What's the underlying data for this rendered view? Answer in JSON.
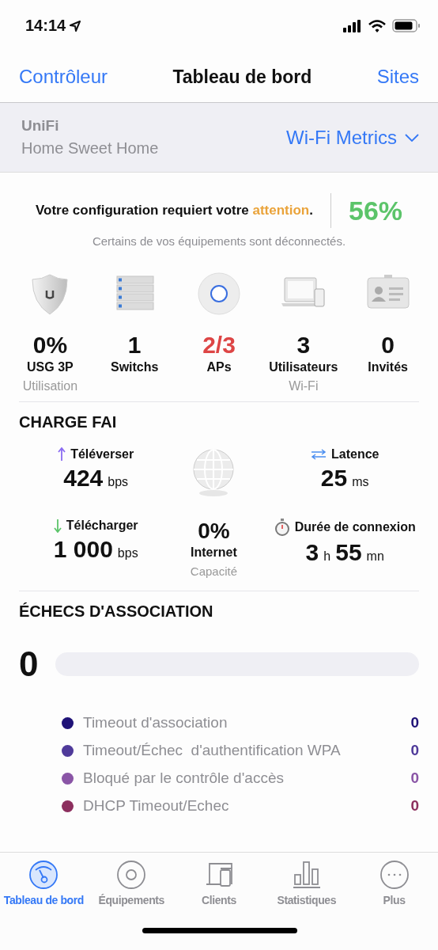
{
  "status_bar": {
    "time": "14:14"
  },
  "nav": {
    "back": "Contrôleur",
    "title": "Tableau de bord",
    "action": "Sites"
  },
  "site": {
    "brand": "UniFi",
    "name": "Home Sweet Home",
    "metric": "Wi-Fi Metrics"
  },
  "health": {
    "message": "Votre configuration requiert votre **attention**.",
    "score": "56%",
    "detail": "Certains de vos équipements sont déconnectés."
  },
  "devices": [
    {
      "kind": "gateway",
      "value": "0%",
      "label": "USG 3P",
      "sublabel": "Utilisation",
      "warning": false
    },
    {
      "kind": "switch",
      "value": "1",
      "label": "Switchs",
      "warning": false
    },
    {
      "kind": "ap",
      "value": "2/3",
      "label": "APs",
      "warning": true
    },
    {
      "kind": "users",
      "value": "3",
      "label": "Utilisateurs",
      "sublabel": "Wi-Fi",
      "warning": false
    },
    {
      "kind": "guests",
      "value": "0",
      "label": "Invités",
      "warning": false
    }
  ],
  "isp_load": {
    "title": "CHARGE FAI",
    "stats": [
      {
        "kind": "upload",
        "label": "Téléverser",
        "parts": [
          {
            "number": "424",
            "unit": "bps"
          }
        ]
      },
      {
        "kind": "globe"
      },
      {
        "kind": "latency",
        "label": "Latence",
        "parts": [
          {
            "number": "25",
            "unit": "ms"
          }
        ]
      },
      {
        "kind": "download",
        "label": "Télécharger",
        "parts": [
          {
            "number": "1 000",
            "unit": "bps"
          }
        ]
      },
      {
        "kind": "capacity",
        "value": "0%",
        "label": "Internet",
        "sublabel": "Capacité"
      },
      {
        "kind": "uptime",
        "label": "Durée de connexion",
        "parts": [
          {
            "number": "3",
            "unit": "h"
          },
          {
            "number": "55",
            "unit": "mn"
          }
        ]
      }
    ]
  },
  "association_failures": {
    "title": "ÉCHECS D'ASSOCIATION",
    "total": "0",
    "level": 0,
    "items": [
      {
        "label": "Timeout d'association",
        "count": "0",
        "color": "#1f1277"
      },
      {
        "label": "Timeout/Échec  d'authentification WPA",
        "count": "0",
        "color": "#4f3a9a"
      },
      {
        "label": "Bloqué par le contrôle d'accès",
        "count": "0",
        "color": "#8a55a6"
      },
      {
        "label": "DHCP Timeout/Echec",
        "count": "0",
        "color": "#8c2f5e"
      }
    ]
  },
  "tab_bar": [
    {
      "kind": "dashboard",
      "label": "Tableau de bord",
      "selected": true
    },
    {
      "kind": "devices",
      "label": "Équipements",
      "selected": false
    },
    {
      "kind": "clients",
      "label": "Clients",
      "selected": false
    },
    {
      "kind": "stats",
      "label": "Statistiques",
      "selected": false
    },
    {
      "kind": "more",
      "label": "Plus",
      "selected": false
    }
  ]
}
